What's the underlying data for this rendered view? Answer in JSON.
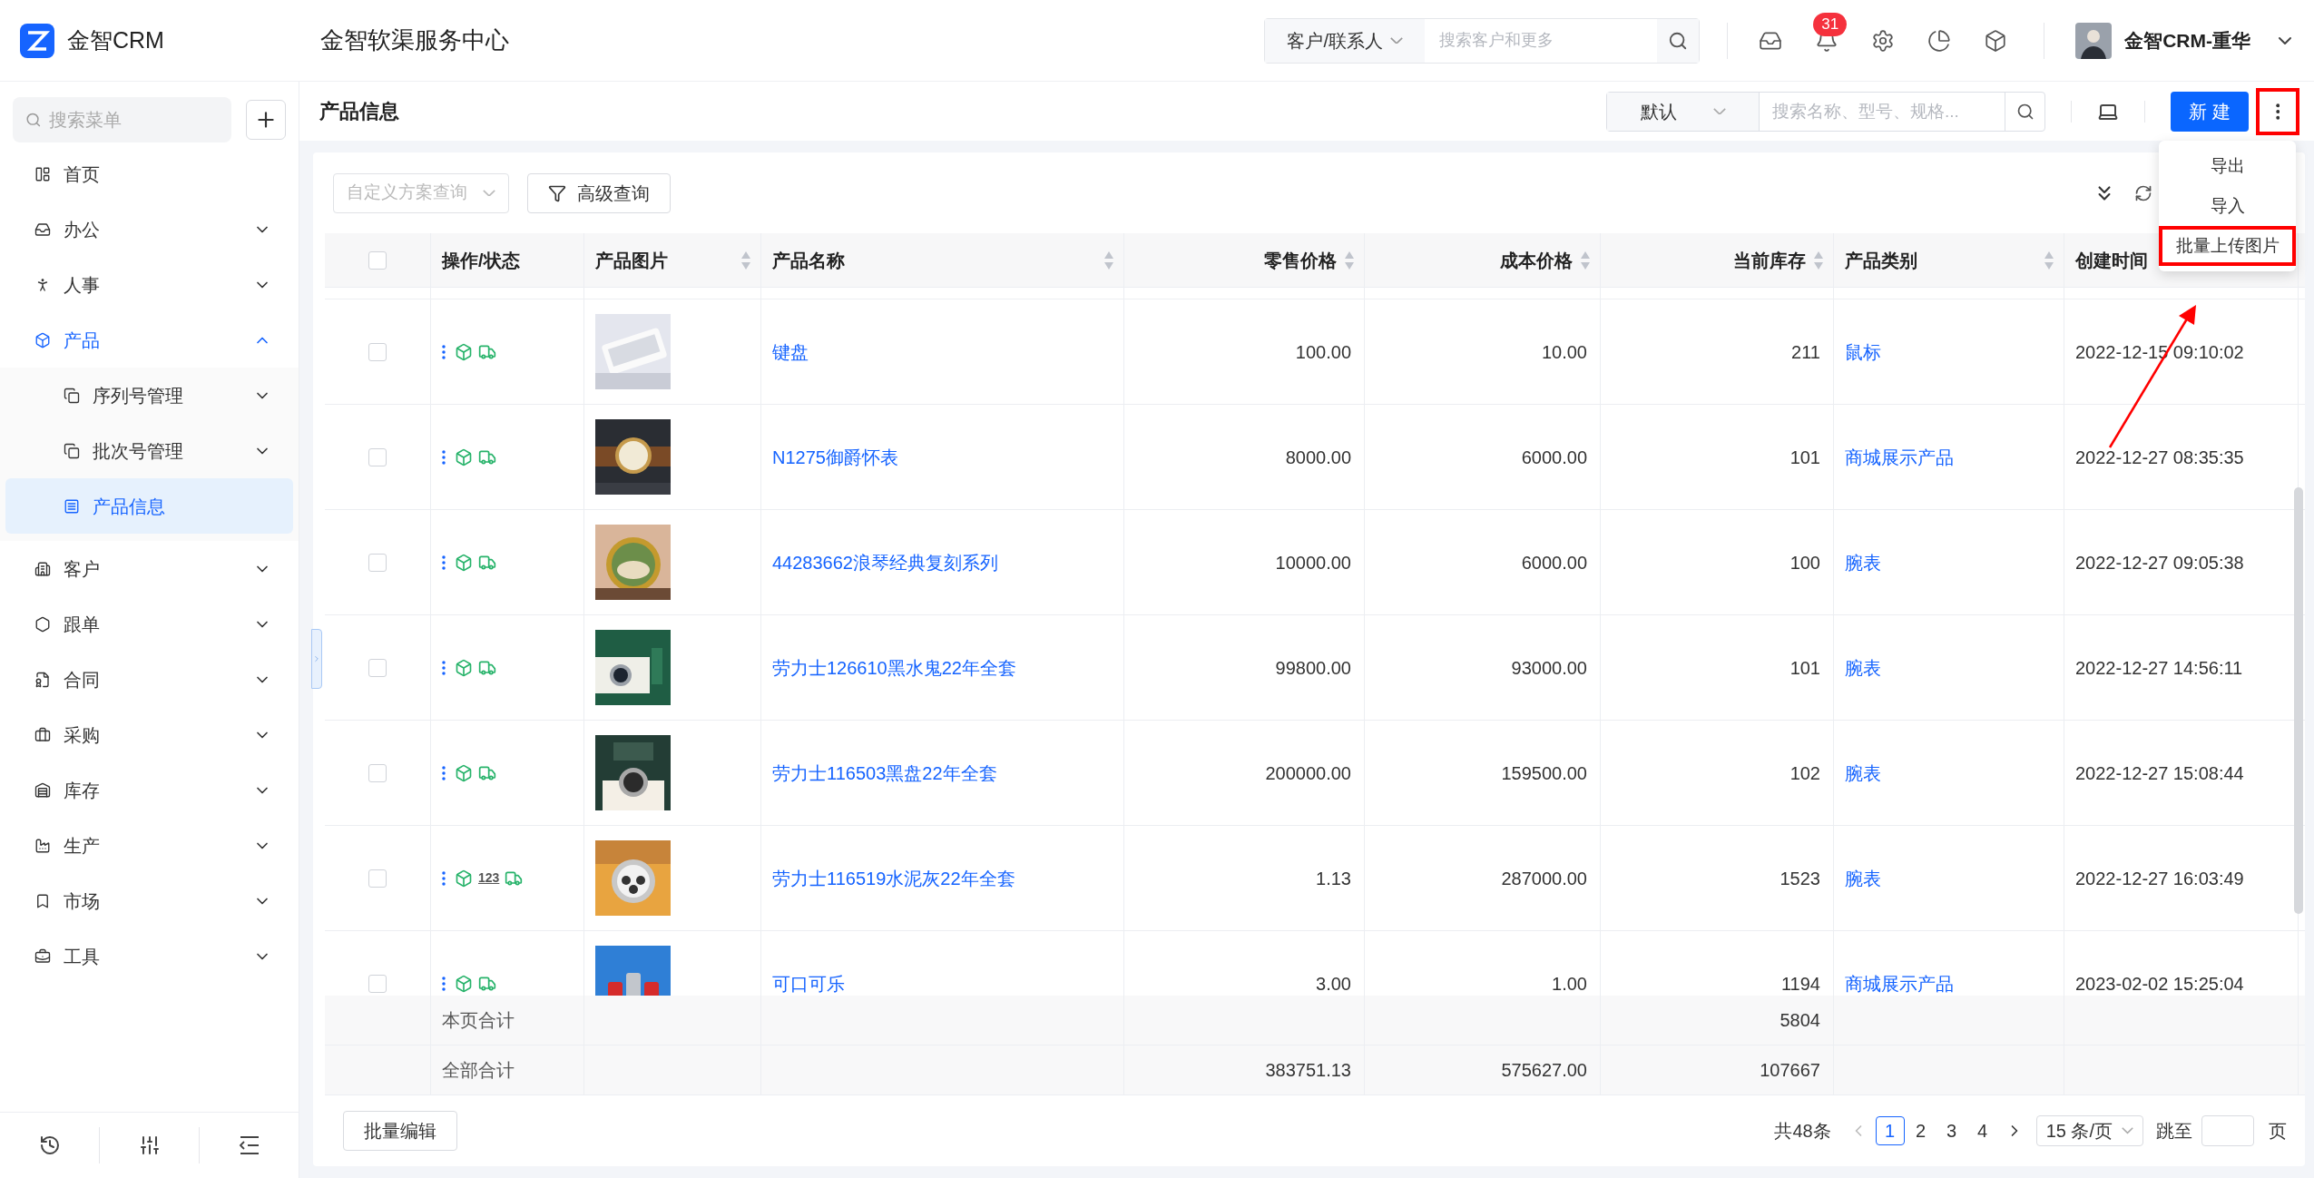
{
  "header": {
    "brand": "金智CRM",
    "title": "金智软渠服务中心",
    "search_scope": "客户/联系人",
    "search": {
      "placeholder": "搜索客户和更多"
    },
    "notification_count": "31",
    "user": "金智CRM-重华"
  },
  "sidebar": {
    "search": {
      "placeholder": "搜索菜单"
    },
    "items": [
      {
        "label": "首页",
        "selected": false
      },
      {
        "label": "办公",
        "expanded": false,
        "selected": false
      },
      {
        "label": "人事",
        "expanded": false,
        "selected": false
      },
      {
        "label": "产品",
        "expanded": true,
        "selected": true,
        "children": [
          {
            "label": "序列号管理",
            "expanded": false,
            "selected": false
          },
          {
            "label": "批次号管理",
            "expanded": false,
            "selected": false
          },
          {
            "label": "产品信息",
            "selected": true
          }
        ]
      },
      {
        "label": "客户",
        "expanded": false,
        "selected": false
      },
      {
        "label": "跟单",
        "expanded": false,
        "selected": false
      },
      {
        "label": "合同",
        "expanded": false,
        "selected": false
      },
      {
        "label": "采购",
        "expanded": false,
        "selected": false
      },
      {
        "label": "库存",
        "expanded": false,
        "selected": false
      },
      {
        "label": "生产",
        "expanded": false,
        "selected": false
      },
      {
        "label": "市场",
        "expanded": false,
        "selected": false
      },
      {
        "label": "工具",
        "expanded": false,
        "selected": false
      }
    ]
  },
  "page": {
    "title": "产品信息",
    "view": "默认",
    "search": {
      "placeholder": "搜索名称、型号、规格..."
    },
    "new_button": "新 建",
    "more_button": {
      "highlighted": true
    },
    "more_menu": [
      {
        "label": "导出",
        "highlighted": false
      },
      {
        "label": "导入",
        "highlighted": false
      },
      {
        "label": "批量上传图片",
        "highlighted": true
      }
    ],
    "scheme_select": {
      "placeholder": "自定义方案查询"
    },
    "advanced_query": "高级查询"
  },
  "table": {
    "columns": [
      {
        "kind": "checkbox",
        "checked": false
      },
      {
        "kind": "text",
        "label": "操作/状态",
        "sortable": false
      },
      {
        "kind": "text",
        "label": "产品图片",
        "sortable": true
      },
      {
        "kind": "text",
        "label": "产品名称",
        "sortable": true
      },
      {
        "kind": "number",
        "label": "零售价格",
        "sortable": true
      },
      {
        "kind": "number",
        "label": "成本价格",
        "sortable": true
      },
      {
        "kind": "number",
        "label": "当前库存",
        "sortable": true
      },
      {
        "kind": "text",
        "label": "产品类别",
        "sortable": true
      },
      {
        "kind": "text",
        "label": "创建时间",
        "sortable": false
      }
    ],
    "rows": [
      {
        "checked": false,
        "name": "键盘",
        "retail_price": "100.00",
        "cost_price": "10.00",
        "stock": "211",
        "category": "鼠标",
        "created": "2022-12-15 09:10:02"
      },
      {
        "checked": false,
        "name": "N1275御爵怀表",
        "retail_price": "8000.00",
        "cost_price": "6000.00",
        "stock": "101",
        "category": "商城展示产品",
        "created": "2022-12-27 08:35:35"
      },
      {
        "checked": false,
        "name": "44283662浪琴经典复刻系列",
        "retail_price": "10000.00",
        "cost_price": "6000.00",
        "stock": "100",
        "category": "腕表",
        "created": "2022-12-27 09:05:38"
      },
      {
        "checked": false,
        "name": "劳力士126610黑水鬼22年全套",
        "retail_price": "99800.00",
        "cost_price": "93000.00",
        "stock": "101",
        "category": "腕表",
        "created": "2022-12-27 14:56:11"
      },
      {
        "checked": false,
        "name": "劳力士116503黑盘22年全套",
        "retail_price": "200000.00",
        "cost_price": "159500.00",
        "stock": "102",
        "category": "腕表",
        "created": "2022-12-27 15:08:44"
      },
      {
        "checked": false,
        "name": "劳力士116519水泥灰22年全套",
        "retail_price": "1.13",
        "cost_price": "287000.00",
        "stock": "1523",
        "category": "腕表",
        "created": "2022-12-27 16:03:49",
        "serial_tag": "123"
      },
      {
        "checked": false,
        "name": "可口可乐",
        "retail_price": "3.00",
        "cost_price": "1.00",
        "stock": "1194",
        "category": "商城展示产品",
        "created": "2023-02-02 15:25:04"
      }
    ],
    "summaries": [
      {
        "label": "本页合计",
        "stock": "5804"
      },
      {
        "label": "全部合计",
        "retail_price": "383751.13",
        "cost_price": "575627.00",
        "stock": "107667"
      }
    ]
  },
  "footer": {
    "batch_edit": "批量编辑",
    "total": "共48条",
    "pages": [
      {
        "label": "1",
        "selected": true
      },
      {
        "label": "2",
        "selected": false
      },
      {
        "label": "3",
        "selected": false
      },
      {
        "label": "4",
        "selected": false
      }
    ],
    "page_size": "15 条/页",
    "jump_label": "跳至",
    "jump_suffix": "页"
  }
}
